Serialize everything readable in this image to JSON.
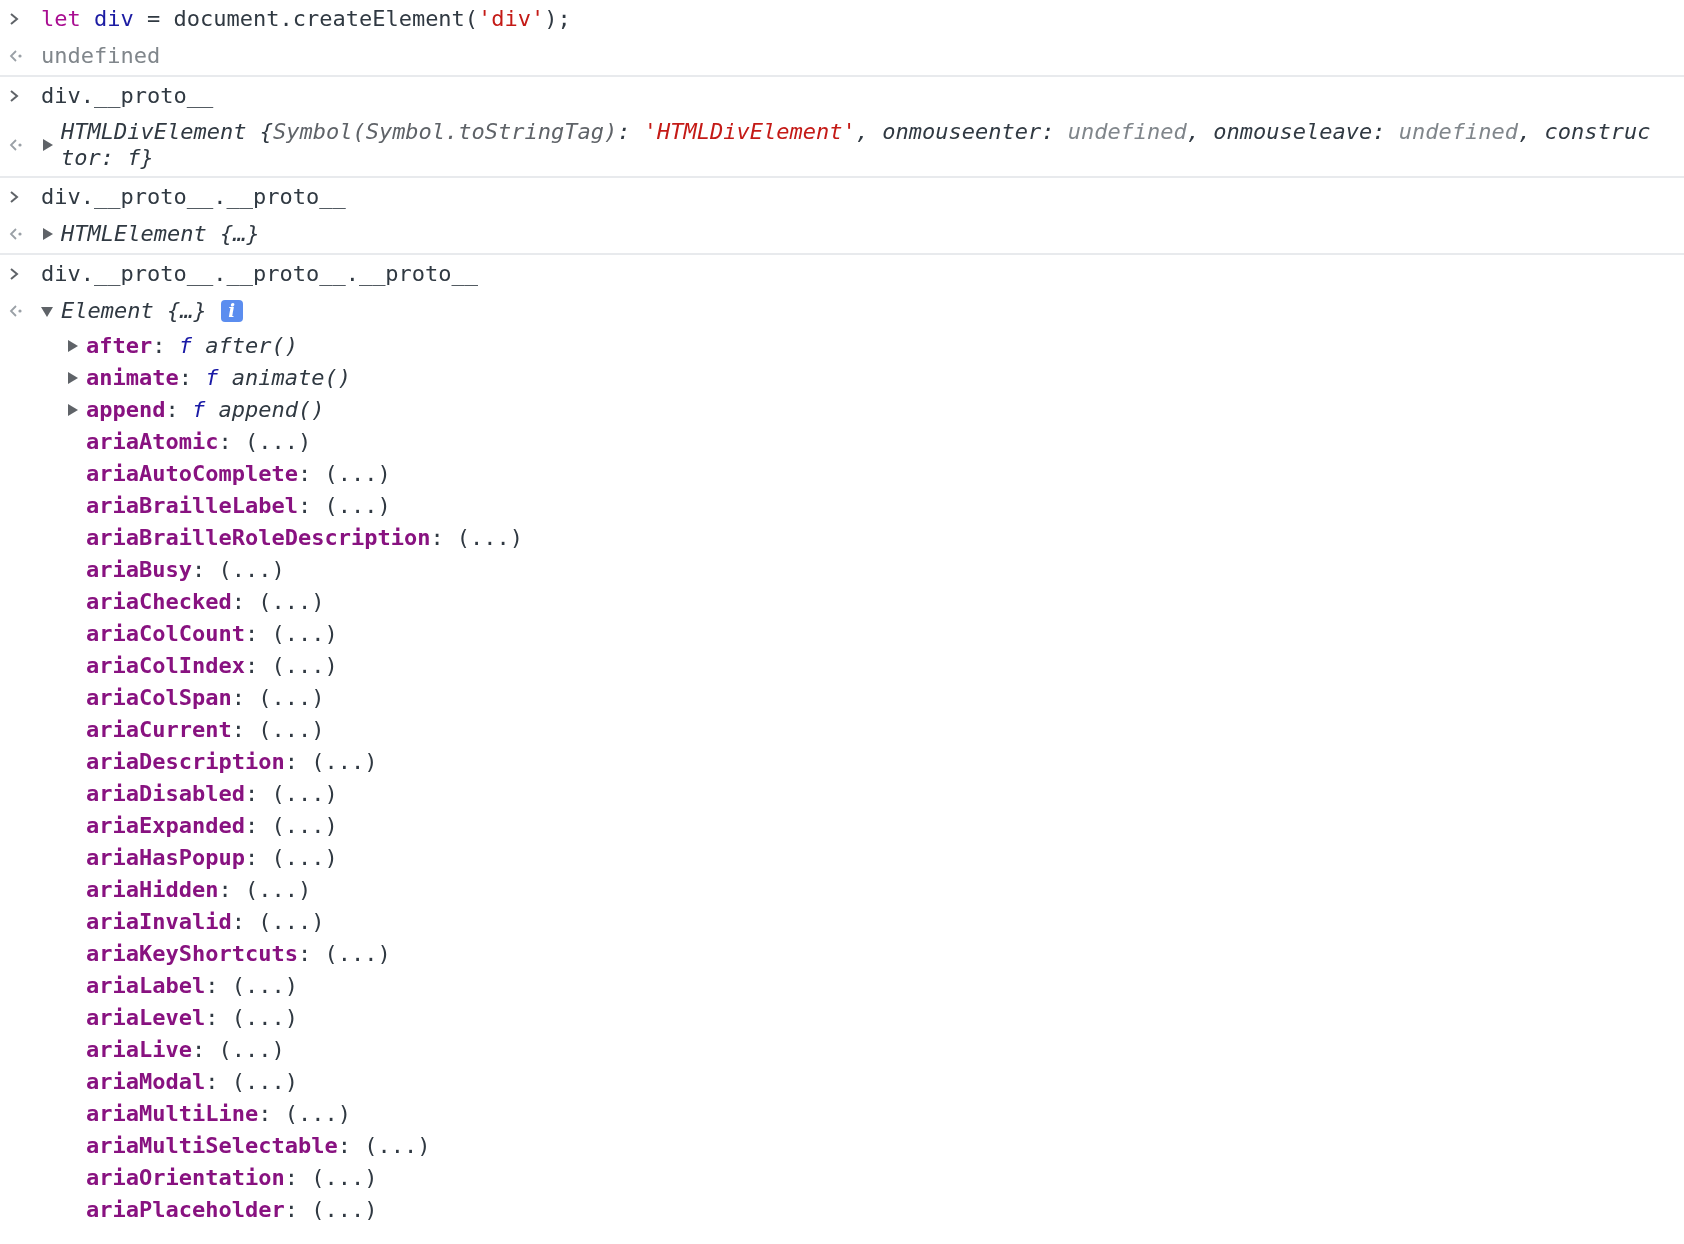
{
  "console": [
    {
      "input": [
        {
          "text": "let ",
          "kind": "keyword"
        },
        {
          "text": "div",
          "kind": "variable"
        },
        {
          "text": " = document.createElement(",
          "kind": "plain"
        },
        {
          "text": "'div'",
          "kind": "string"
        },
        {
          "text": ");",
          "kind": "plain"
        }
      ],
      "output": {
        "kind": "value",
        "tokens": [
          {
            "text": "undefined",
            "kind": "muted"
          }
        ]
      }
    },
    {
      "input": [
        {
          "text": "div.__proto__",
          "kind": "plain"
        }
      ],
      "output": {
        "kind": "object",
        "expanded": false,
        "tokens": [
          {
            "text": "HTMLDivElement {",
            "kind": "obj"
          },
          {
            "text": "Symbol(Symbol.toStringTag)",
            "kind": "obj-key-muted"
          },
          {
            "text": ": ",
            "kind": "obj"
          },
          {
            "text": "'HTMLDivElement'",
            "kind": "obj-string"
          },
          {
            "text": ", onmouseenter: ",
            "kind": "obj"
          },
          {
            "text": "undefined",
            "kind": "obj-muted"
          },
          {
            "text": ", onmouseleave: ",
            "kind": "obj"
          },
          {
            "text": "undefined",
            "kind": "obj-muted"
          },
          {
            "text": ", constructor: f}",
            "kind": "obj"
          }
        ]
      }
    },
    {
      "input": [
        {
          "text": "div.__proto__.__proto__",
          "kind": "plain"
        }
      ],
      "output": {
        "kind": "object",
        "expanded": false,
        "tokens": [
          {
            "text": "HTMLElement {…}",
            "kind": "obj"
          }
        ]
      }
    },
    {
      "input": [
        {
          "text": "div.__proto__.__proto__.__proto__",
          "kind": "plain"
        }
      ],
      "output": {
        "kind": "object",
        "expanded": true,
        "badge": "i",
        "tokens": [
          {
            "text": "Element {…}",
            "kind": "obj"
          }
        ],
        "children": [
          {
            "kind": "function",
            "expanded": false,
            "tokens": [
              {
                "text": "after",
                "kind": "prop"
              },
              {
                "text": ": ",
                "kind": "plain"
              },
              {
                "text": "f",
                "kind": "fn"
              },
              {
                "text": " after()",
                "kind": "obj"
              }
            ]
          },
          {
            "kind": "function",
            "expanded": false,
            "tokens": [
              {
                "text": "animate",
                "kind": "prop"
              },
              {
                "text": ": ",
                "kind": "plain"
              },
              {
                "text": "f",
                "kind": "fn"
              },
              {
                "text": " animate()",
                "kind": "obj"
              }
            ]
          },
          {
            "kind": "function",
            "expanded": false,
            "tokens": [
              {
                "text": "append",
                "kind": "prop"
              },
              {
                "text": ": ",
                "kind": "plain"
              },
              {
                "text": "f",
                "kind": "fn"
              },
              {
                "text": " append()",
                "kind": "obj"
              }
            ]
          },
          {
            "kind": "accessor",
            "tokens": [
              {
                "text": "ariaAtomic",
                "kind": "prop"
              },
              {
                "text": ": (...)",
                "kind": "plain"
              }
            ]
          },
          {
            "kind": "accessor",
            "tokens": [
              {
                "text": "ariaAutoComplete",
                "kind": "prop"
              },
              {
                "text": ": (...)",
                "kind": "plain"
              }
            ]
          },
          {
            "kind": "accessor",
            "tokens": [
              {
                "text": "ariaBrailleLabel",
                "kind": "prop"
              },
              {
                "text": ": (...)",
                "kind": "plain"
              }
            ]
          },
          {
            "kind": "accessor",
            "tokens": [
              {
                "text": "ariaBrailleRoleDescription",
                "kind": "prop"
              },
              {
                "text": ": (...)",
                "kind": "plain"
              }
            ]
          },
          {
            "kind": "accessor",
            "tokens": [
              {
                "text": "ariaBusy",
                "kind": "prop"
              },
              {
                "text": ": (...)",
                "kind": "plain"
              }
            ]
          },
          {
            "kind": "accessor",
            "tokens": [
              {
                "text": "ariaChecked",
                "kind": "prop"
              },
              {
                "text": ": (...)",
                "kind": "plain"
              }
            ]
          },
          {
            "kind": "accessor",
            "tokens": [
              {
                "text": "ariaColCount",
                "kind": "prop"
              },
              {
                "text": ": (...)",
                "kind": "plain"
              }
            ]
          },
          {
            "kind": "accessor",
            "tokens": [
              {
                "text": "ariaColIndex",
                "kind": "prop"
              },
              {
                "text": ": (...)",
                "kind": "plain"
              }
            ]
          },
          {
            "kind": "accessor",
            "tokens": [
              {
                "text": "ariaColSpan",
                "kind": "prop"
              },
              {
                "text": ": (...)",
                "kind": "plain"
              }
            ]
          },
          {
            "kind": "accessor",
            "tokens": [
              {
                "text": "ariaCurrent",
                "kind": "prop"
              },
              {
                "text": ": (...)",
                "kind": "plain"
              }
            ]
          },
          {
            "kind": "accessor",
            "tokens": [
              {
                "text": "ariaDescription",
                "kind": "prop"
              },
              {
                "text": ": (...)",
                "kind": "plain"
              }
            ]
          },
          {
            "kind": "accessor",
            "tokens": [
              {
                "text": "ariaDisabled",
                "kind": "prop"
              },
              {
                "text": ": (...)",
                "kind": "plain"
              }
            ]
          },
          {
            "kind": "accessor",
            "tokens": [
              {
                "text": "ariaExpanded",
                "kind": "prop"
              },
              {
                "text": ": (...)",
                "kind": "plain"
              }
            ]
          },
          {
            "kind": "accessor",
            "tokens": [
              {
                "text": "ariaHasPopup",
                "kind": "prop"
              },
              {
                "text": ": (...)",
                "kind": "plain"
              }
            ]
          },
          {
            "kind": "accessor",
            "tokens": [
              {
                "text": "ariaHidden",
                "kind": "prop"
              },
              {
                "text": ": (...)",
                "kind": "plain"
              }
            ]
          },
          {
            "kind": "accessor",
            "tokens": [
              {
                "text": "ariaInvalid",
                "kind": "prop"
              },
              {
                "text": ": (...)",
                "kind": "plain"
              }
            ]
          },
          {
            "kind": "accessor",
            "tokens": [
              {
                "text": "ariaKeyShortcuts",
                "kind": "prop"
              },
              {
                "text": ": (...)",
                "kind": "plain"
              }
            ]
          },
          {
            "kind": "accessor",
            "tokens": [
              {
                "text": "ariaLabel",
                "kind": "prop"
              },
              {
                "text": ": (...)",
                "kind": "plain"
              }
            ]
          },
          {
            "kind": "accessor",
            "tokens": [
              {
                "text": "ariaLevel",
                "kind": "prop"
              },
              {
                "text": ": (...)",
                "kind": "plain"
              }
            ]
          },
          {
            "kind": "accessor",
            "tokens": [
              {
                "text": "ariaLive",
                "kind": "prop"
              },
              {
                "text": ": (...)",
                "kind": "plain"
              }
            ]
          },
          {
            "kind": "accessor",
            "tokens": [
              {
                "text": "ariaModal",
                "kind": "prop"
              },
              {
                "text": ": (...)",
                "kind": "plain"
              }
            ]
          },
          {
            "kind": "accessor",
            "tokens": [
              {
                "text": "ariaMultiLine",
                "kind": "prop"
              },
              {
                "text": ": (...)",
                "kind": "plain"
              }
            ]
          },
          {
            "kind": "accessor",
            "tokens": [
              {
                "text": "ariaMultiSelectable",
                "kind": "prop"
              },
              {
                "text": ": (...)",
                "kind": "plain"
              }
            ]
          },
          {
            "kind": "accessor",
            "tokens": [
              {
                "text": "ariaOrientation",
                "kind": "prop"
              },
              {
                "text": ": (...)",
                "kind": "plain"
              }
            ]
          },
          {
            "kind": "accessor",
            "tokens": [
              {
                "text": "ariaPlaceholder",
                "kind": "prop"
              },
              {
                "text": ": (...)",
                "kind": "plain"
              }
            ]
          }
        ]
      }
    }
  ]
}
